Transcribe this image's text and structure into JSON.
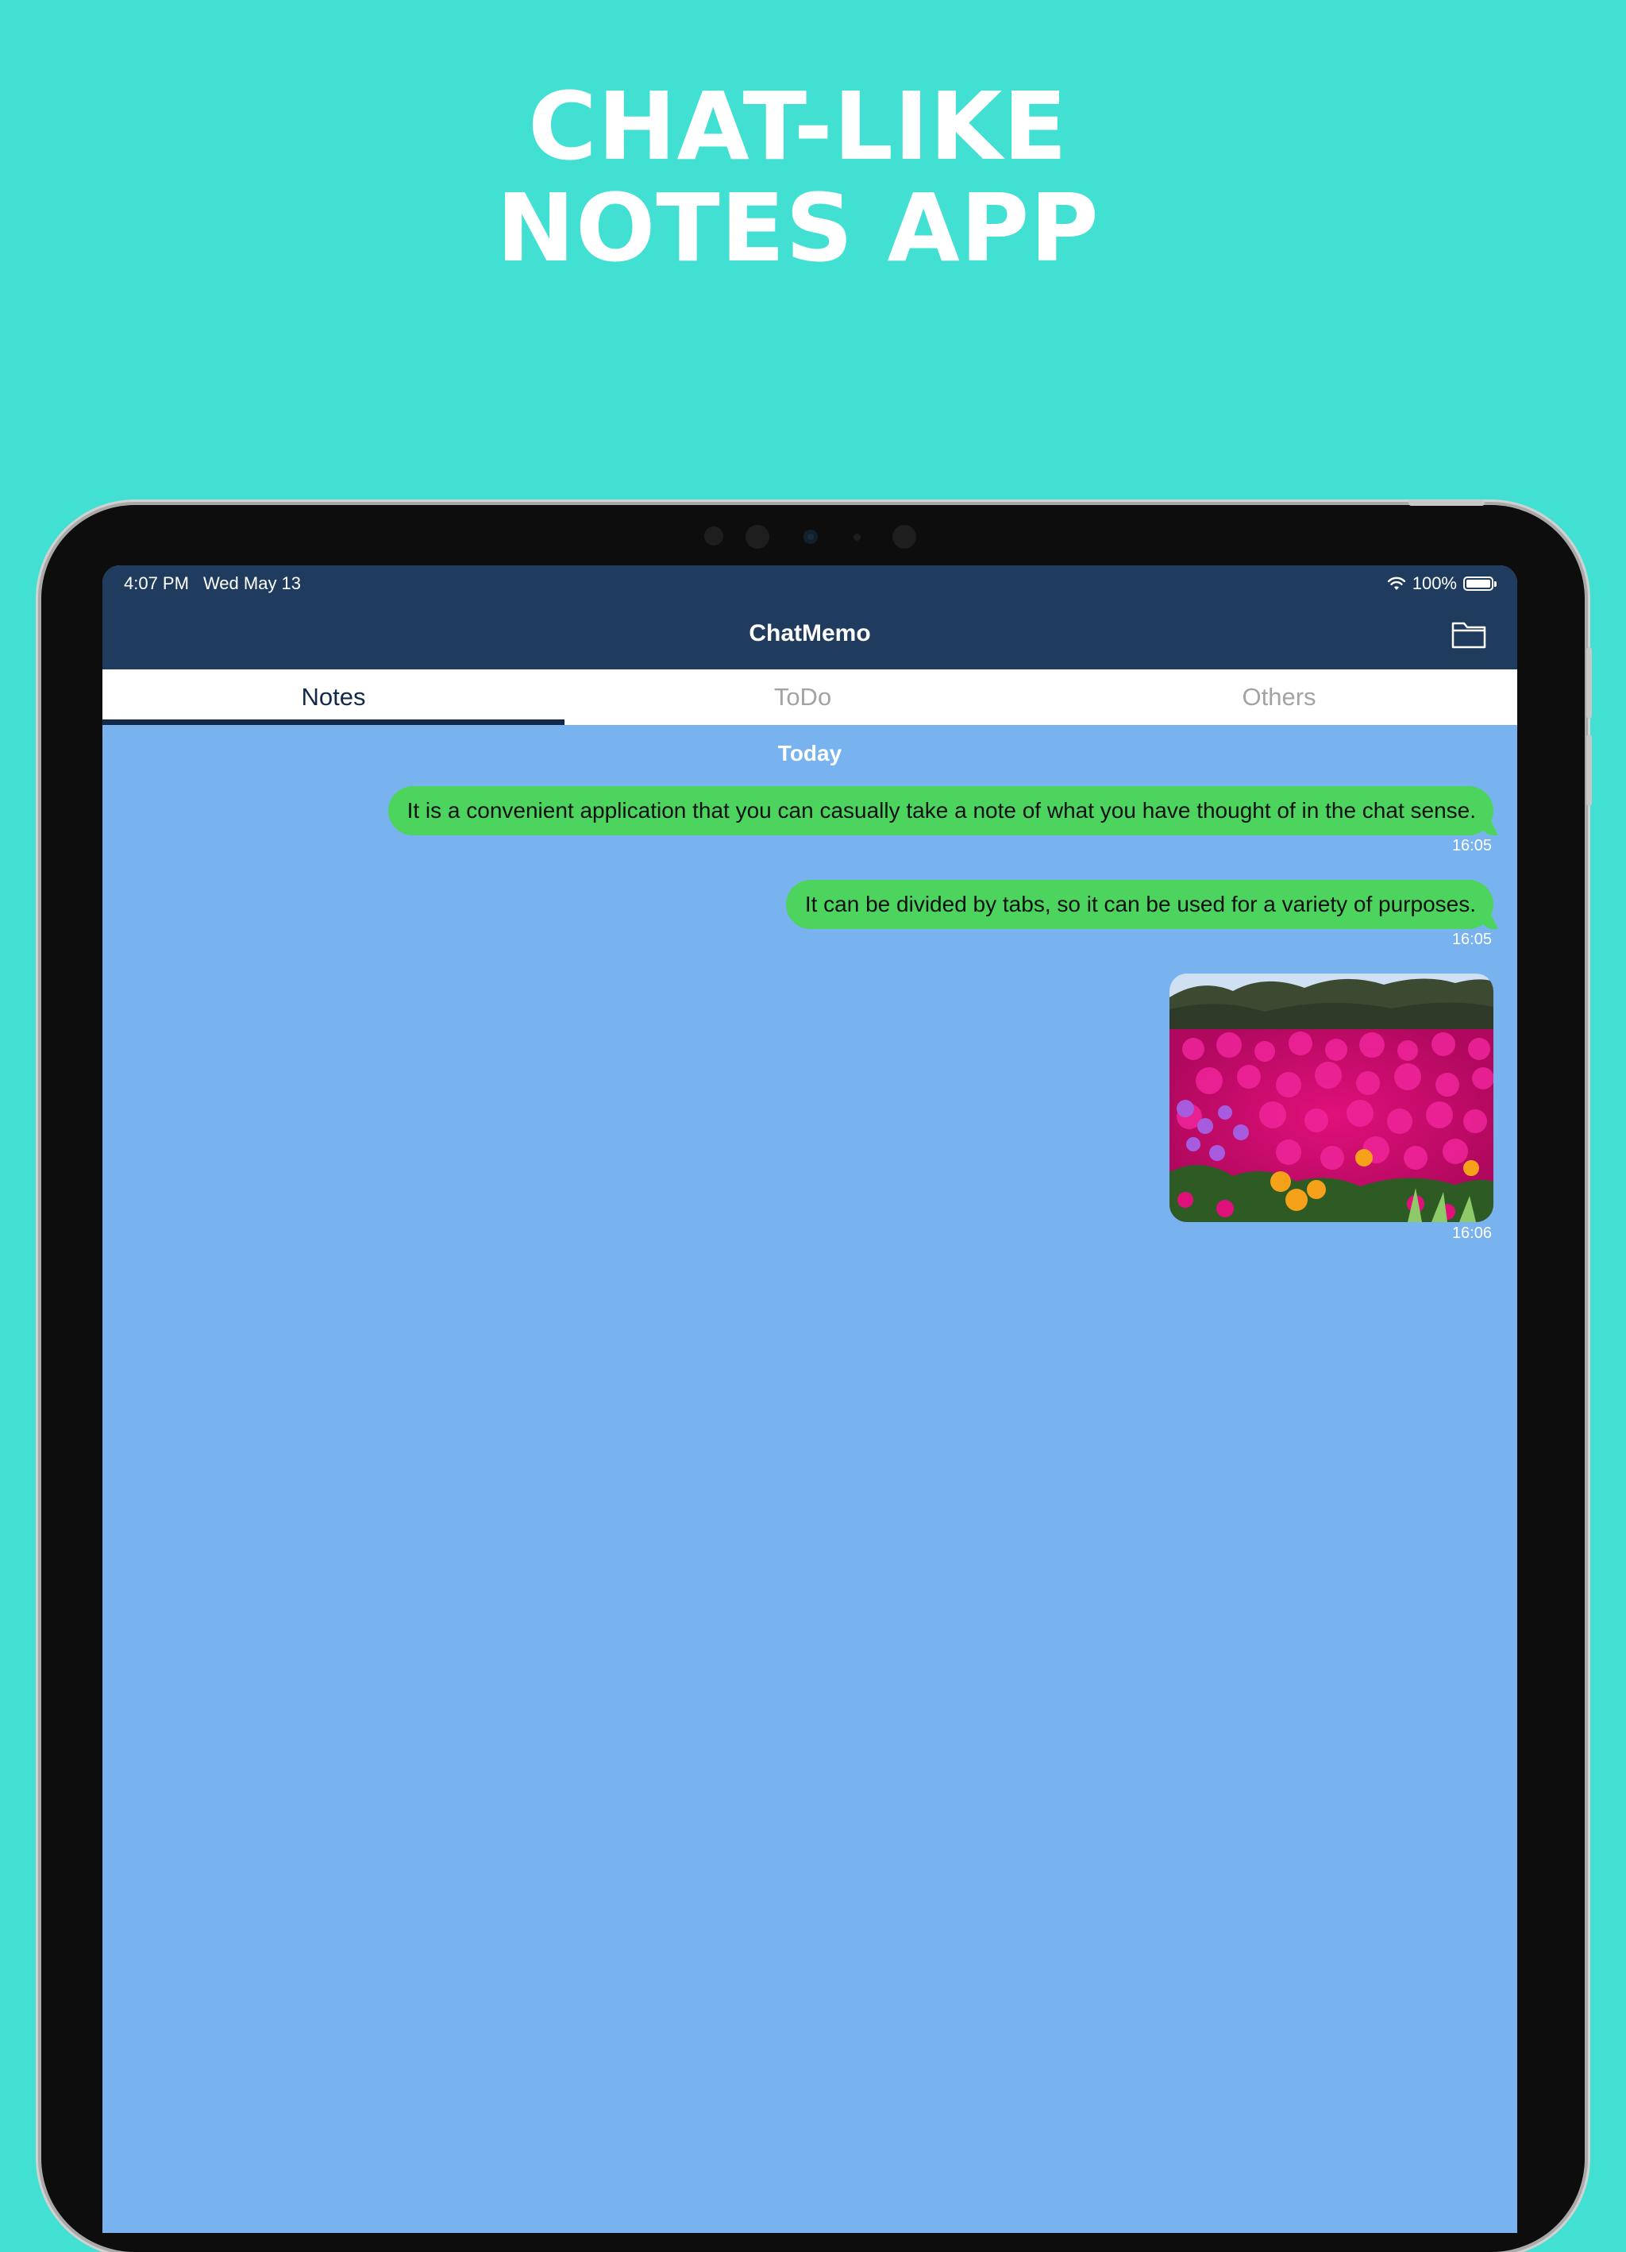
{
  "promo": {
    "headline_line1": "CHAT-LIKE",
    "headline_line2": "NOTES APP"
  },
  "status_bar": {
    "time": "4:07 PM",
    "date": "Wed May 13",
    "battery": "100%",
    "wifi_icon": "wifi-icon",
    "battery_icon": "battery-icon"
  },
  "nav": {
    "title": "ChatMemo",
    "folder_icon": "folder-icon"
  },
  "tabs": [
    {
      "label": "Notes",
      "active": true
    },
    {
      "label": "ToDo",
      "active": false
    },
    {
      "label": "Others",
      "active": false
    }
  ],
  "chat": {
    "date_separator": "Today",
    "messages": [
      {
        "type": "text",
        "text": "It is a convenient application that you can casually take a note of what you have thought of in the chat sense.",
        "time": "16:05"
      },
      {
        "type": "text",
        "text": "It can be divided by tabs, so it can be used for a variety of purposes.",
        "time": "16:05"
      },
      {
        "type": "image",
        "description": "photo-flowers",
        "time": "16:06"
      }
    ]
  },
  "colors": {
    "background": "#41e0d2",
    "nav": "#1f3c5f",
    "chat_bg": "#78b3f0",
    "bubble": "#4cd45f",
    "tab_active": "#13294a",
    "tab_inactive": "#a3a3a3"
  }
}
